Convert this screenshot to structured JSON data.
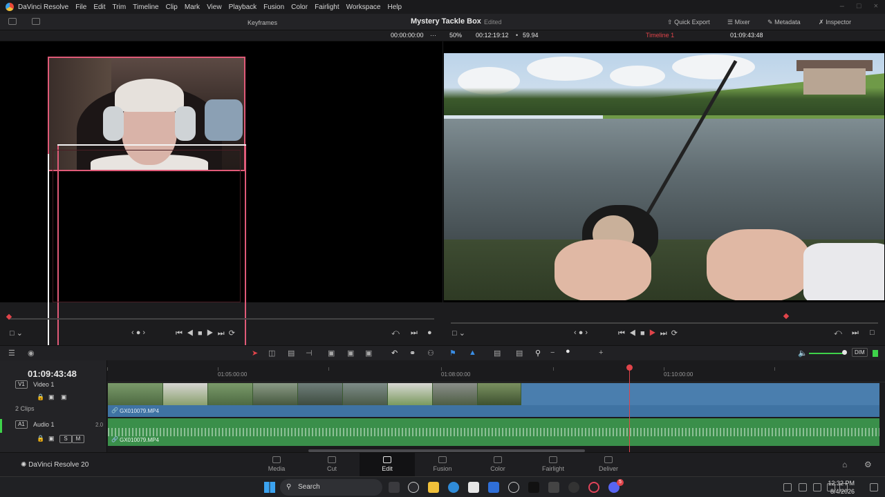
{
  "menubar": {
    "app_name": "DaVinci Resolve",
    "items": [
      "File",
      "Edit",
      "Trim",
      "Timeline",
      "Clip",
      "Mark",
      "View",
      "Playback",
      "Fusion",
      "Color",
      "Fairlight",
      "Workspace",
      "Help"
    ]
  },
  "toolbar": {
    "keyframes_label": "Keyframes",
    "project_title": "Mystery Tackle Box",
    "project_status": "Edited",
    "quick_export": "Quick Export",
    "mixer": "Mixer",
    "metadata": "Metadata",
    "inspector": "Inspector"
  },
  "viewer": {
    "source_timecode": "00:00:00:00",
    "zoom": "50%",
    "duration": "00:12:19:12",
    "fps": "59.94",
    "timeline_name": "Timeline 1",
    "program_timecode": "01:09:43:48"
  },
  "timeline": {
    "current_timecode": "01:09:43:48",
    "ruler": [
      "01:05:00:00",
      "01:08:00:00",
      "01:10:00:00"
    ],
    "video_track_label": "Video 1",
    "video_track_tag": "V1",
    "clip_count": "2 Clips",
    "video_clip_name": "GX010079.MP4",
    "audio_track_tag": "A1",
    "audio_track_label": "Audio 1",
    "audio_channels": "2.0",
    "audio_clip_name": "GX010079.MP4",
    "dim_label": "DIM",
    "solo_label": "S",
    "mute_label": "M"
  },
  "pages": {
    "brand": "DaVinci Resolve 20",
    "tabs": [
      {
        "label": "Media",
        "active": false
      },
      {
        "label": "Cut",
        "active": false
      },
      {
        "label": "Edit",
        "active": true
      },
      {
        "label": "Fusion",
        "active": false
      },
      {
        "label": "Color",
        "active": false
      },
      {
        "label": "Fairlight",
        "active": false
      },
      {
        "label": "Deliver",
        "active": false
      }
    ]
  },
  "taskbar": {
    "search_placeholder": "Search",
    "time": "12:32 PM",
    "date": "8/4/2026",
    "discord_badge": "5"
  },
  "colors": {
    "accent_red": "#e0444a",
    "overlay_pink": "#e05a78",
    "video_clip_blue": "#4a7eae",
    "audio_clip_green": "#3a8f4a"
  }
}
